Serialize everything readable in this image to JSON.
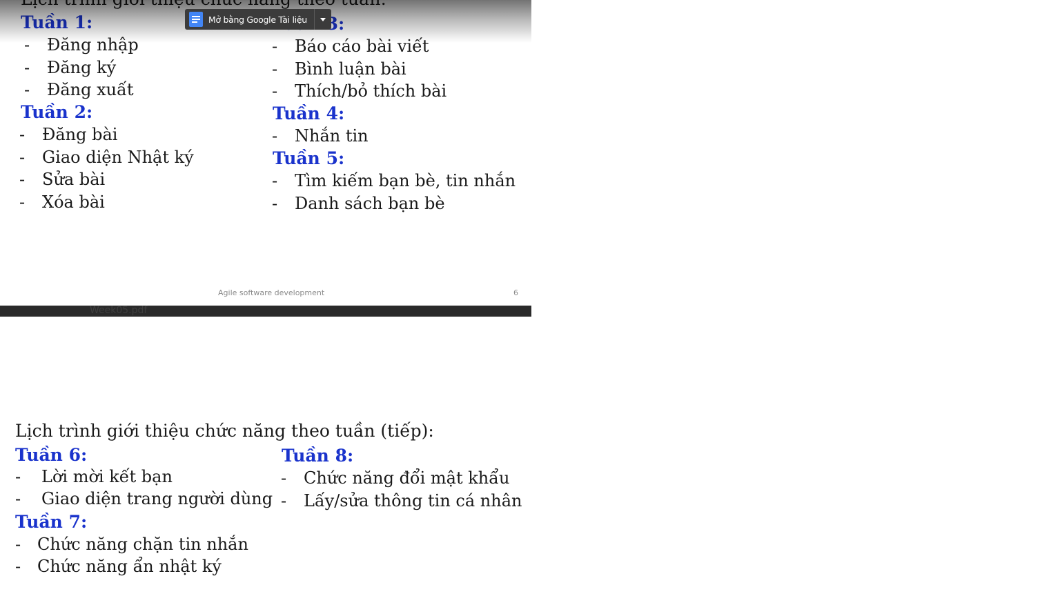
{
  "top_slide": {
    "cut_title": "Lịch trình giới thiệu chức năng theo tuần:",
    "open_with_button": {
      "label": "Mở bằng Google Tài liệu",
      "icon": "google-docs-icon"
    },
    "columns": [
      [
        {
          "week": "Tuần 1:",
          "items": [
            "Đăng nhập",
            "Đăng ký",
            "Đăng xuất"
          ]
        },
        {
          "week": "Tuần 2:",
          "items": [
            "Đăng bài",
            "Giao diện Nhật ký",
            "Sửa bài",
            "Xóa bài"
          ]
        }
      ],
      [
        {
          "week": "Tuần 3:",
          "items": [
            "Báo cáo bài viết",
            "Bình luận bài",
            "Thích/bỏ thích bài"
          ]
        },
        {
          "week": "Tuần 4:",
          "items": [
            "Nhắn tin"
          ]
        },
        {
          "week": "Tuần 5:",
          "items": [
            "Tìm kiếm bạn bè, tin nhắn",
            "Danh sách bạn bè"
          ]
        }
      ]
    ],
    "footer_text": "Agile software development",
    "page_number": "6"
  },
  "viewer_bar": {
    "filename": "Week05.pdf"
  },
  "bottom_slide": {
    "title": "Lịch trình giới thiệu chức năng theo tuần (tiếp):",
    "columns": [
      [
        {
          "week": "Tuần 6:",
          "items": [
            "Lời mời kết bạn",
            "Giao diện trang người dùng"
          ]
        },
        {
          "week": "Tuần 7:",
          "items": [
            "Chức năng chặn tin nhắn",
            "Chức năng ẩn nhật ký"
          ]
        }
      ],
      [
        {
          "week": "Tuần 8:",
          "items": [
            "Chức năng đổi mật khẩu",
            "Lấy/sửa thông tin cá nhân"
          ]
        }
      ]
    ]
  },
  "colors": {
    "week_heading": "#1a33cc",
    "text": "#1a1a1a",
    "viewer_bar": "#2a2a2a",
    "docs_icon": "#4285f4"
  }
}
